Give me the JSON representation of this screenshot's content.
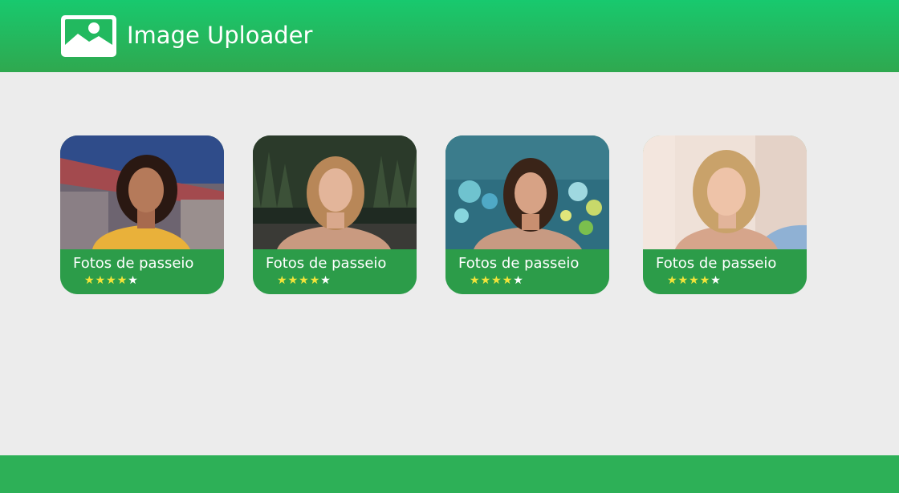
{
  "app": {
    "title": "Image Uploader",
    "logo_icon": "image-icon",
    "brand_colors": {
      "header_top": "#18c96e",
      "header_bottom": "#2fa84f",
      "card": "#2c9c49",
      "footer": "#2db057",
      "star_on": "#f2e43a",
      "star_off": "#ffffff"
    }
  },
  "gallery": {
    "cards": [
      {
        "caption": "Fotos de passeio",
        "rating": 4,
        "max_rating": 5,
        "photo_icon": "portrait-photo"
      },
      {
        "caption": "Fotos de passeio",
        "rating": 4,
        "max_rating": 5,
        "photo_icon": "portrait-photo"
      },
      {
        "caption": "Fotos de passeio",
        "rating": 4,
        "max_rating": 5,
        "photo_icon": "portrait-photo"
      },
      {
        "caption": "Fotos de passeio",
        "rating": 4,
        "max_rating": 5,
        "photo_icon": "portrait-photo"
      }
    ]
  }
}
